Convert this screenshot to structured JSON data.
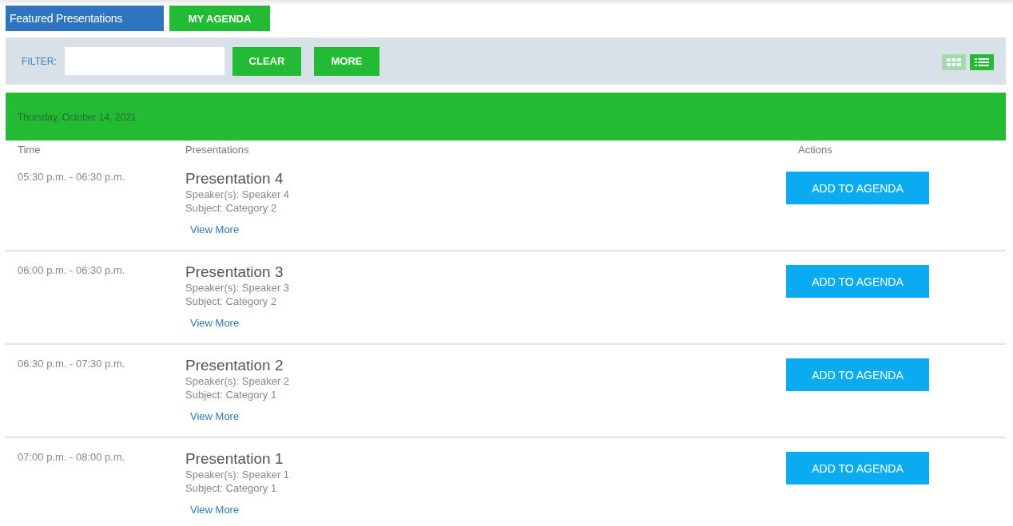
{
  "tabs": [
    {
      "label": "Featured Presentations",
      "selected": true
    },
    {
      "label": "MY AGENDA",
      "selected": false
    }
  ],
  "filter": {
    "label": "FILTER:",
    "buttons": [
      "CLEAR",
      "MORE"
    ]
  },
  "view_toggle": [
    {
      "kind": "grid",
      "selected": false
    },
    {
      "kind": "list",
      "selected": true
    }
  ],
  "day": {
    "date": "Thursday, October 14, 2021"
  },
  "table": {
    "columns": [
      "Time",
      "Presentations",
      "Actions"
    ],
    "rows": [
      {
        "time": "05:30 p.m. - 06:30 p.m.",
        "title": "Presentation 4",
        "speakers": "Speaker(s): Speaker 4",
        "subject": "Subject: Category 2",
        "link": "View More",
        "action": "ADD TO AGENDA"
      },
      {
        "time": "06:00 p.m. - 06:30 p.m.",
        "title": "Presentation 3",
        "speakers": "Speaker(s): Speaker 3",
        "subject": "Subject: Category 2",
        "link": "View More",
        "action": "ADD TO AGENDA"
      },
      {
        "time": "06:30 p.m. - 07:30 p.m.",
        "title": "Presentation 2",
        "speakers": "Speaker(s): Speaker 2",
        "subject": "Subject: Category 1",
        "link": "View More",
        "action": "ADD TO AGENDA"
      },
      {
        "time": "07:00 p.m. - 08:00 p.m.",
        "title": "Presentation 1",
        "speakers": "Speaker(s): Speaker 1",
        "subject": "Subject: Category 1",
        "link": "View More",
        "action": "ADD TO AGENDA"
      }
    ]
  }
}
